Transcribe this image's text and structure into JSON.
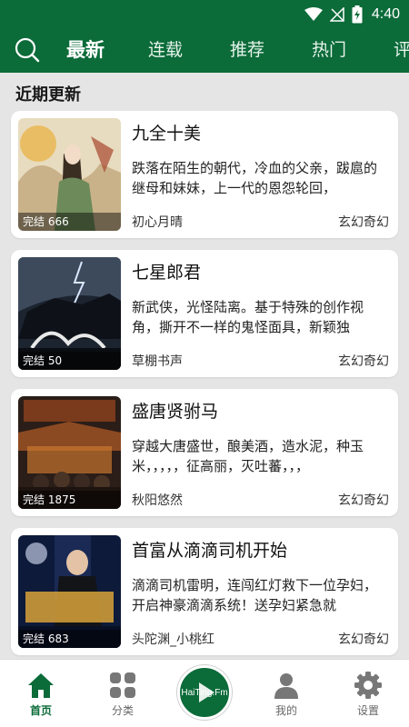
{
  "status_bar": {
    "time": "4:40"
  },
  "top_bar": {
    "tabs": [
      {
        "label": "最新"
      },
      {
        "label": "连载"
      },
      {
        "label": "推荐"
      },
      {
        "label": "热门"
      },
      {
        "label": "评"
      }
    ]
  },
  "section": {
    "title": "近期更新"
  },
  "books": [
    {
      "title": "九全十美",
      "description": "跌落在陌生的朝代，冷血的父亲，跋扈的继母和妹妹，上一代的恩怨轮回，",
      "author": "初心月晴",
      "genre": "玄幻奇幻",
      "status": "完结 666"
    },
    {
      "title": "七星郎君",
      "description": "新武侠，光怪陆离。基于特殊的创作视角，撕开不一样的鬼怪面具，新颖独",
      "author": "草棚书声",
      "genre": "玄幻奇幻",
      "status": "完结 50"
    },
    {
      "title": "盛唐贤驸马",
      "description": "穿越大唐盛世，酿美酒，造水泥，种玉米，，，，，征高丽，灭吐蕃，，，",
      "author": "秋阳悠然",
      "genre": "玄幻奇幻",
      "status": "完结 1875"
    },
    {
      "title": "首富从滴滴司机开始",
      "description": "滴滴司机雷明，连闯红灯救下一位孕妇，开启神豪滴滴系统！送孕妇紧急就",
      "author": "头陀渊_小桃红",
      "genre": "玄幻奇幻",
      "status": "完结 683"
    }
  ],
  "bottom_nav": {
    "items": [
      {
        "label": "首页"
      },
      {
        "label": "分类"
      },
      {
        "label": "我的"
      },
      {
        "label": "设置"
      }
    ],
    "radio_label": "HaiTing.Fm"
  },
  "colors": {
    "primary": "#0b6b39",
    "background": "#e5e5e5",
    "card": "#ffffff"
  }
}
